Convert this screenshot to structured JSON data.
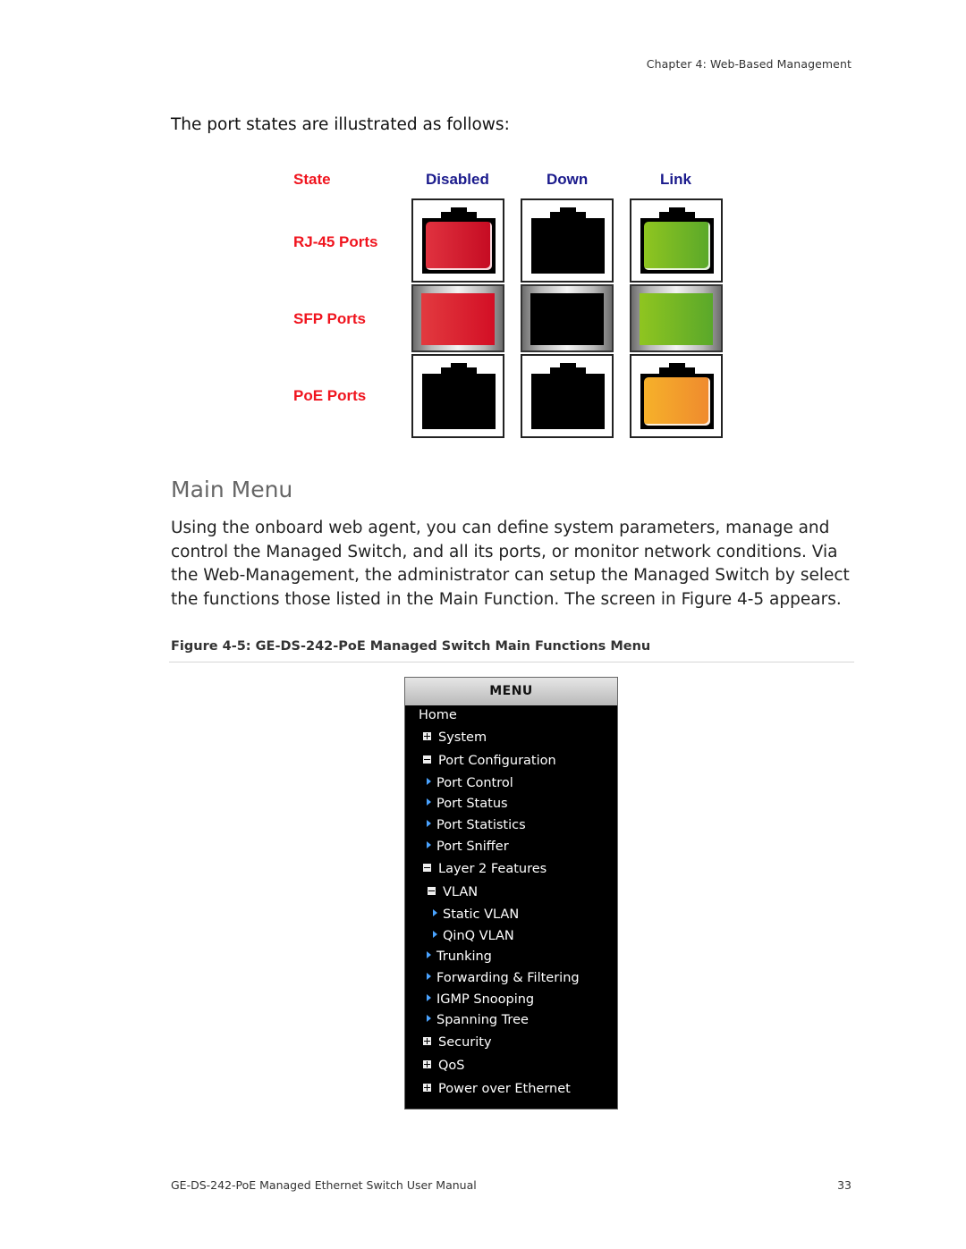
{
  "header": {
    "chapter": "Chapter 4: Web-Based Management"
  },
  "intro": "The port states are illustrated as follows:",
  "port_table": {
    "state_label": "State",
    "columns": [
      "Disabled",
      "Down",
      "Link"
    ],
    "rows": [
      {
        "label": "RJ-45 Ports",
        "type": "rj45",
        "states": [
          "red",
          "black",
          "green"
        ]
      },
      {
        "label": "SFP Ports",
        "type": "sfp",
        "states": [
          "red",
          "black",
          "green"
        ]
      },
      {
        "label": "PoE Ports",
        "type": "rj45",
        "states": [
          "black",
          "black",
          "orange"
        ]
      }
    ],
    "colors": {
      "red": "#d91a2e",
      "green": "#74b626",
      "orange": "#f39e2c",
      "label_red": "#f0141e",
      "label_blue": "#1a1a8c"
    }
  },
  "section": {
    "title": "Main Menu",
    "paragraph": "Using the onboard web agent, you can define system parameters, manage and control the Managed Switch, and all its ports, or monitor network conditions. Via the Web-Management, the administrator can setup the Managed Switch by select the functions those listed in the Main Function. The screen in Figure 4-5 appears.",
    "figure_caption": "Figure 4-5:  GE-DS-242-PoE Managed Switch Main Functions Menu"
  },
  "menu": {
    "title": "MENU",
    "items": [
      {
        "label": "Home",
        "icon": "none",
        "level": 0
      },
      {
        "label": "System",
        "icon": "plus-box-icon",
        "level": 1
      },
      {
        "label": "Port Configuration",
        "icon": "minus-box-icon",
        "level": 1
      },
      {
        "label": "Port Control",
        "icon": "arrow-right-icon",
        "level": 2
      },
      {
        "label": "Port Status",
        "icon": "arrow-right-icon",
        "level": 2
      },
      {
        "label": "Port Statistics",
        "icon": "arrow-right-icon",
        "level": 2
      },
      {
        "label": "Port Sniffer",
        "icon": "arrow-right-icon",
        "level": 2
      },
      {
        "label": "Layer 2 Features",
        "icon": "minus-box-icon",
        "level": 1
      },
      {
        "label": "VLAN",
        "icon": "minus-box-icon",
        "level": 2
      },
      {
        "label": "Static VLAN",
        "icon": "arrow-right-icon",
        "level": 3
      },
      {
        "label": "QinQ VLAN",
        "icon": "arrow-right-icon",
        "level": 3
      },
      {
        "label": "Trunking",
        "icon": "arrow-right-icon",
        "level": 2
      },
      {
        "label": "Forwarding & Filtering",
        "icon": "arrow-right-icon",
        "level": 2
      },
      {
        "label": "IGMP Snooping",
        "icon": "arrow-right-icon",
        "level": 2
      },
      {
        "label": "Spanning Tree",
        "icon": "arrow-right-icon",
        "level": 2
      },
      {
        "label": "Security",
        "icon": "plus-box-icon",
        "level": 1
      },
      {
        "label": "QoS",
        "icon": "plus-box-icon",
        "level": 1
      },
      {
        "label": "Power over Ethernet",
        "icon": "plus-box-icon",
        "level": 1
      }
    ]
  },
  "footer": {
    "manual": "GE-DS-242-PoE Managed Ethernet Switch User Manual",
    "page": "33"
  }
}
